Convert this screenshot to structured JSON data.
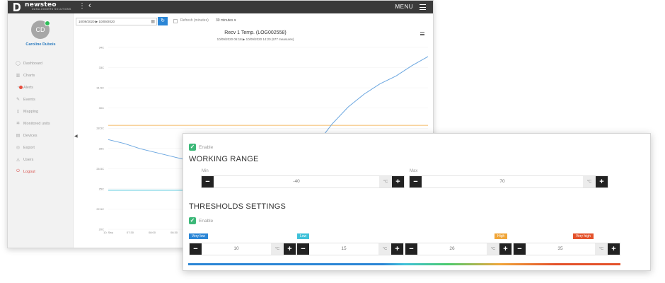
{
  "header": {
    "brand": "newsteo",
    "brand_sub": "DATALOGGERS SOLUTIONS",
    "menu_label": "MENU"
  },
  "user": {
    "initials": "CD",
    "name": "Caroline Dubois"
  },
  "sidebar": {
    "items": [
      {
        "label": "Dashboard",
        "icon": "dashboard-icon"
      },
      {
        "label": "Charts",
        "icon": "chart-icon"
      },
      {
        "label": "Alerts",
        "icon": "bell-icon"
      },
      {
        "label": "Events",
        "icon": "events-icon"
      },
      {
        "label": "Mapping",
        "icon": "map-icon"
      },
      {
        "label": "Monitored units",
        "icon": "gear-icon"
      },
      {
        "label": "Devices",
        "icon": "device-icon"
      },
      {
        "label": "Export",
        "icon": "export-icon"
      },
      {
        "label": "Users",
        "icon": "user-icon"
      },
      {
        "label": "Logout",
        "icon": "power-icon"
      }
    ]
  },
  "toolbar": {
    "date_range": "10/09/2020 ▶ 10/09/2020",
    "refresh_label": "Refresh (minutes)",
    "interval": "30 minutes"
  },
  "chart": {
    "title": "Recv 1 Temp. (LOG002558)",
    "subtitle": "10/09/2020 06:18 ▶ 10/09/2020 14:20 (577 measures)"
  },
  "chart_data": {
    "type": "line",
    "title": "Recv 1 Temp. (LOG002558)",
    "ylim": [
      20,
      34
    ],
    "y_ticks": [
      "20C",
      "22.5C",
      "25C",
      "26.5C",
      "28C",
      "28.5C",
      "30C",
      "31.5C",
      "33C",
      "34C"
    ],
    "x_ticks": [
      "10. Sep",
      "07:30",
      "08:00",
      "08:30"
    ],
    "series": [
      {
        "x": [
          0,
          5,
          10,
          15,
          20,
          25,
          30,
          35,
          40,
          45,
          50,
          55,
          60,
          65,
          70,
          75,
          80,
          85,
          90,
          95,
          100
        ],
        "values": [
          26.9,
          26.6,
          26.2,
          25.9,
          25.6,
          25.3,
          25.0,
          24.7,
          24.4,
          24.2,
          24.0,
          24.3,
          25.1,
          26.5,
          28.1,
          29.4,
          30.4,
          31.2,
          31.8,
          32.6,
          33.3
        ]
      }
    ],
    "reference_lines": [
      {
        "value": 28,
        "color": "#f0a63a"
      },
      {
        "value": 23,
        "color": "#3fc1d9"
      }
    ]
  },
  "settings": {
    "enable_label": "Enable",
    "working_range": {
      "title": "WORKING RANGE",
      "min_label": "Min",
      "max_label": "Max",
      "min_value": "-40",
      "max_value": "70",
      "unit": "°C"
    },
    "thresholds": {
      "title": "THRESHOLDS SETTINGS",
      "enable_label": "Enable",
      "unit": "°C",
      "items": [
        {
          "label": "Very low",
          "value": "10",
          "color": "#2b86d6"
        },
        {
          "label": "Low",
          "value": "15",
          "color": "#3fc1d9"
        },
        {
          "label": "High",
          "value": "26",
          "color": "#f0a63a"
        },
        {
          "label": "Very high",
          "value": "35",
          "color": "#e4522b"
        }
      ]
    }
  }
}
